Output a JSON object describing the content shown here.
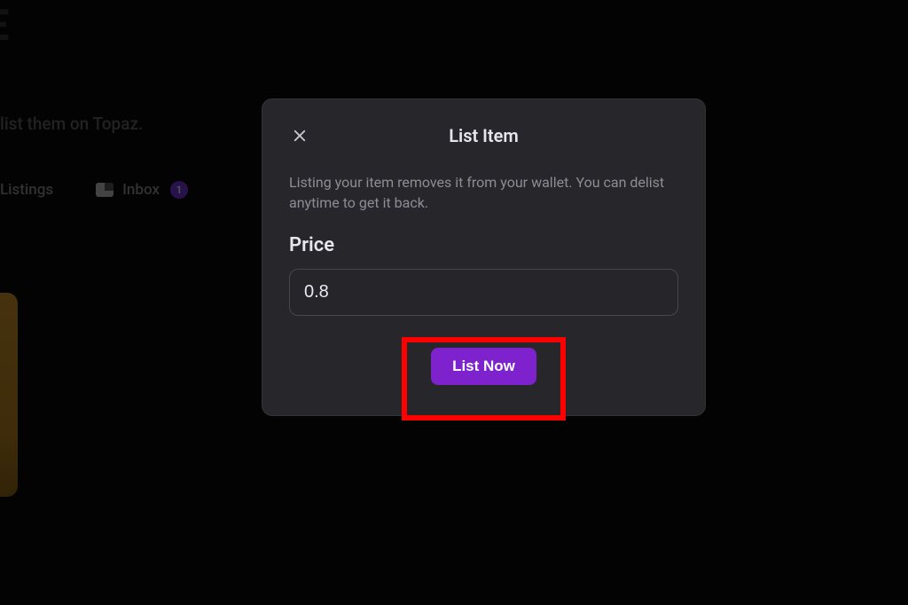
{
  "background": {
    "header_fragment": "_E",
    "subtitle_fragment": "list them on Topaz.",
    "tabs": {
      "listings_label": "Listings",
      "inbox_label": "Inbox",
      "inbox_count": "1"
    }
  },
  "modal": {
    "title": "List Item",
    "description": "Listing your item removes it from your wallet. You can delist anytime to get it back.",
    "price_label": "Price",
    "price_value": "0.8",
    "submit_label": "List Now"
  },
  "colors": {
    "accent": "#7e22ce",
    "highlight": "#ff0000"
  }
}
